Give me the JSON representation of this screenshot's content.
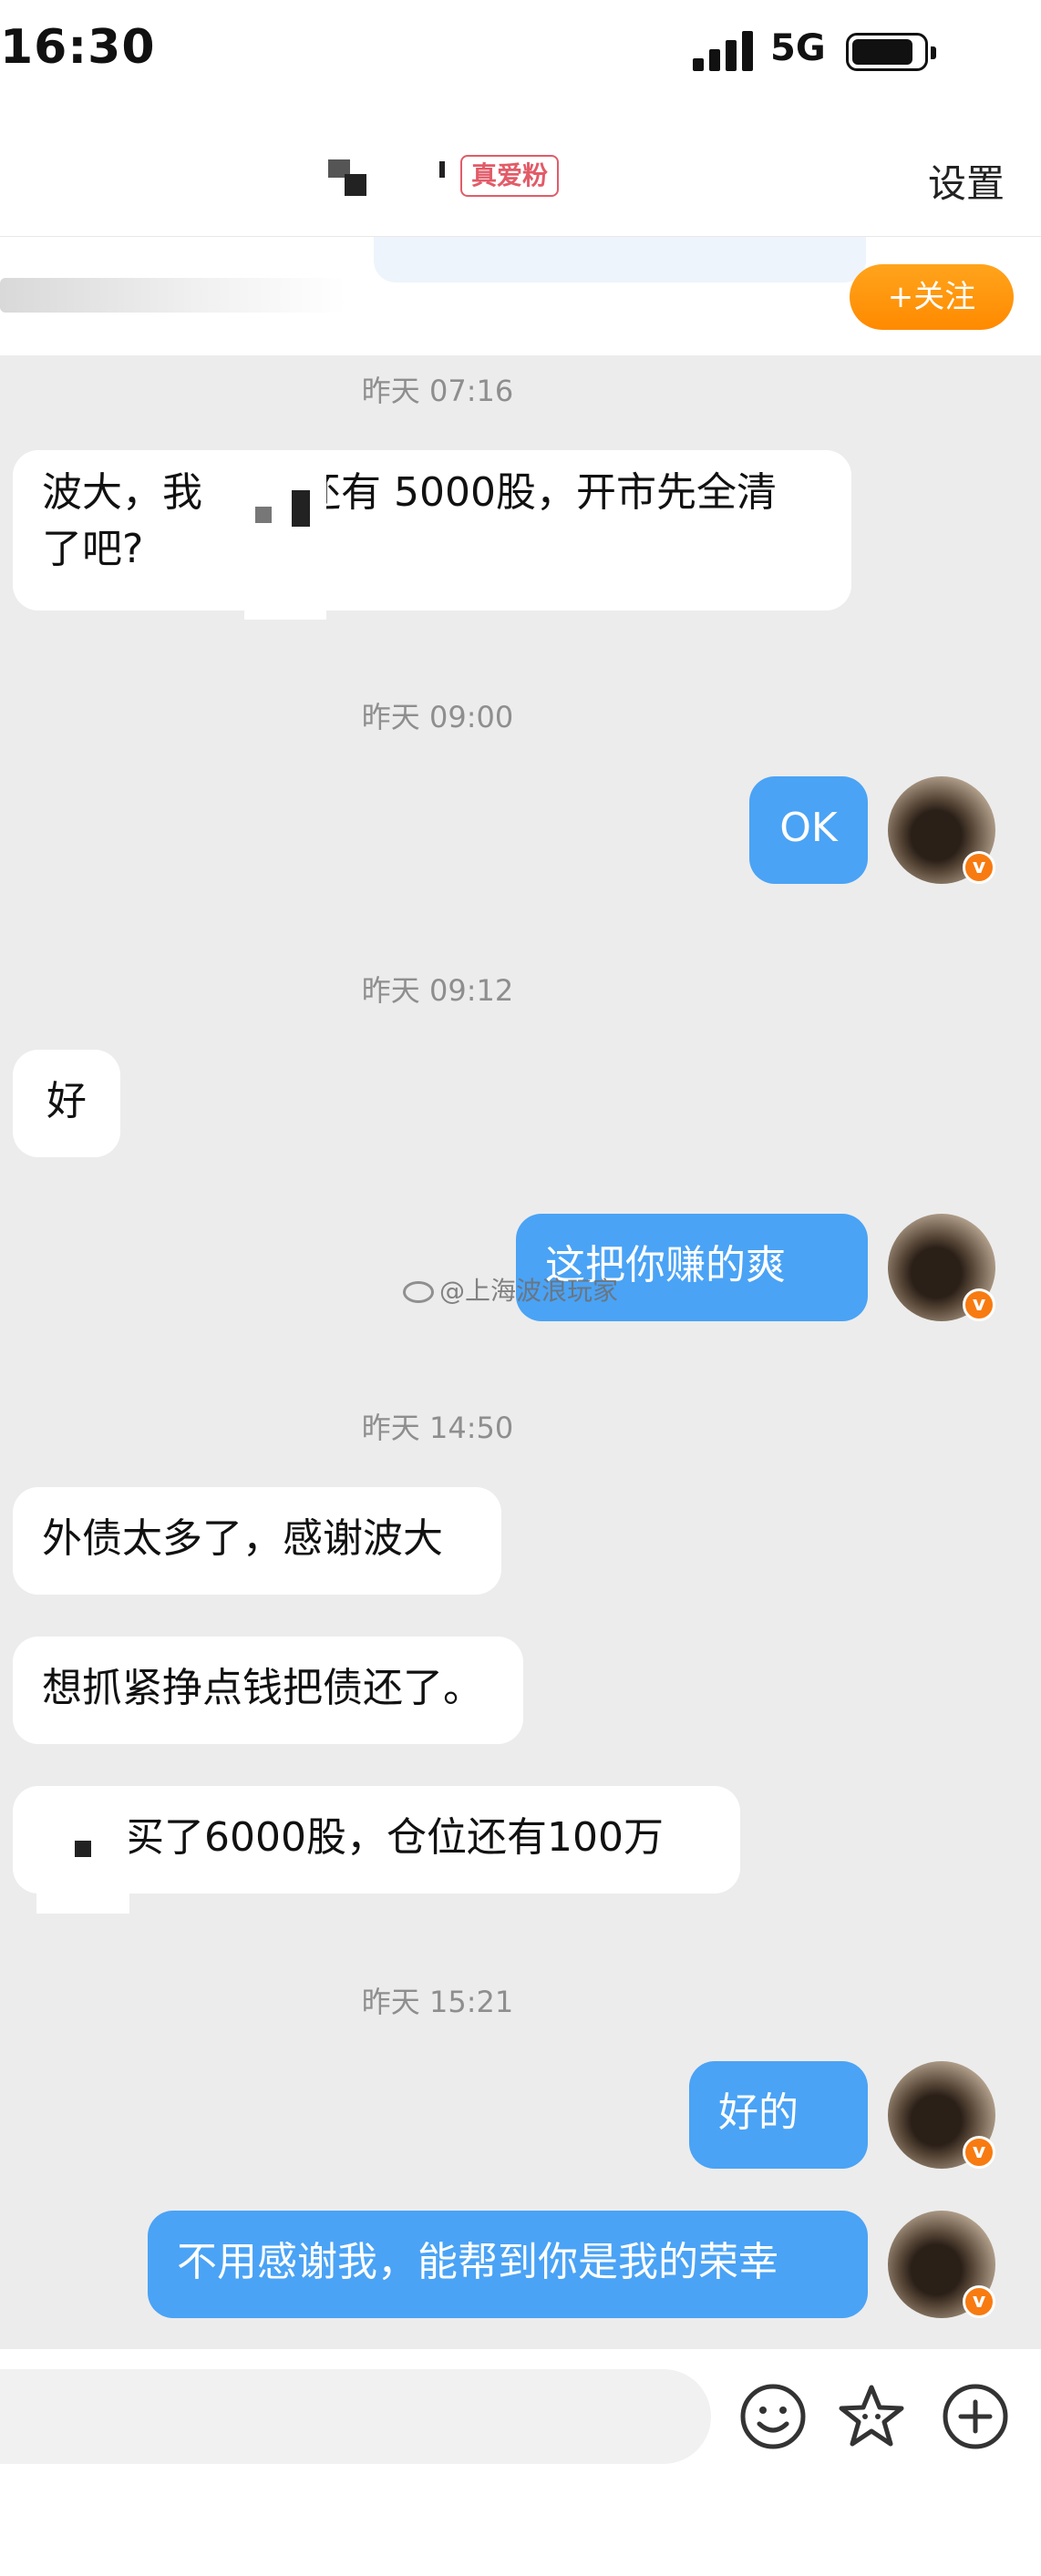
{
  "status_bar": {
    "time": "16:30",
    "network": "5G"
  },
  "header": {
    "fan_badge": "真爱粉",
    "settings_label": "设置"
  },
  "strip": {
    "follow_label": "+关注"
  },
  "messages": {
    "ts1": "昨天 07:16",
    "m1_a": "波大，我",
    "m1_b": "还有 5000股，开市先全清",
    "m1_c": "了吧?",
    "ts2": "昨天 09:00",
    "m2": "OK",
    "ts3": "昨天 09:12",
    "m3": "好",
    "m4": "这把你赚的爽",
    "ts4": "昨天 14:50",
    "m5": "外债太多了，感谢波大",
    "m6": "想抓紧挣点钱把债还了。",
    "m7": "买了6000股，仓位还有100万",
    "ts5": "昨天 15:21",
    "m8": "好的",
    "m9": "不用感谢我，能帮到你是我的荣幸"
  },
  "watermark": "@上海波浪玩家",
  "icons": [
    "signal-icon",
    "battery-icon",
    "verified-badge-icon",
    "emoji-icon",
    "sticker-icon",
    "plus-icon"
  ],
  "colors": {
    "outgoing_bubble": "#4aa3f5",
    "follow_button": "#ff8a00",
    "fan_badge": "#e25b68"
  }
}
